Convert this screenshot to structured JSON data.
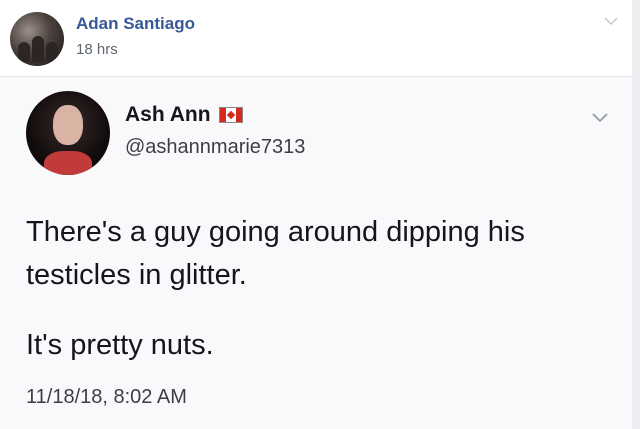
{
  "post": {
    "author_name": "Adan Santiago",
    "time": "18 hrs",
    "menu_icon": "chevron-down-icon"
  },
  "tweet": {
    "display_name": "Ash Ann",
    "flag_icon": "canada-flag-icon",
    "handle": "@ashannmarie7313",
    "text_line1": "There's a guy going around dipping his",
    "text_line2": "testicles in glitter.",
    "text_line3": "It's pretty nuts.",
    "timestamp": "11/18/18, 8:02 AM",
    "menu_icon": "chevron-down-icon"
  }
}
